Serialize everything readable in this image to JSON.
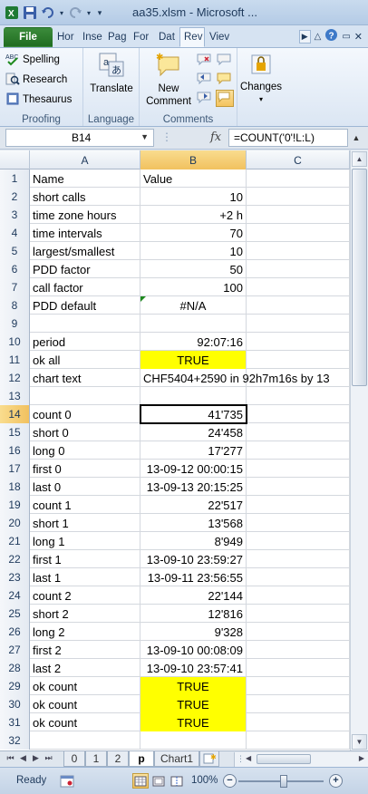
{
  "window": {
    "title": "aa35.xlsm - Microsoft ..."
  },
  "ribbon_tabs": [
    "File",
    "Hor",
    "Inse",
    "Pag",
    "For",
    "Dat",
    "Rev",
    "Viev"
  ],
  "ribbon": {
    "proofing": {
      "spelling": "Spelling",
      "research": "Research",
      "thesaurus": "Thesaurus",
      "label": "Proofing"
    },
    "language": {
      "translate": "Translate",
      "label": "Language"
    },
    "comments": {
      "new_comment_line1": "New",
      "new_comment_line2": "Comment",
      "label": "Comments"
    },
    "changes": {
      "label": "Changes"
    }
  },
  "formula_bar": {
    "name_box": "B14",
    "fx": "fx",
    "formula": "=COUNT('0'!L:L)"
  },
  "columns": [
    "A",
    "B",
    "C"
  ],
  "rows": [
    {
      "n": "1",
      "a": "Name",
      "b": "Value"
    },
    {
      "n": "2",
      "a": "short calls",
      "b": "10"
    },
    {
      "n": "3",
      "a": "time zone hours",
      "b": "+2 h"
    },
    {
      "n": "4",
      "a": "time intervals",
      "b": "70"
    },
    {
      "n": "5",
      "a": "largest/smallest",
      "b": "10"
    },
    {
      "n": "6",
      "a": "PDD factor",
      "b": "50"
    },
    {
      "n": "7",
      "a": "call factor",
      "b": "100"
    },
    {
      "n": "8",
      "a": "PDD default",
      "b": "#N/A"
    },
    {
      "n": "9",
      "a": "",
      "b": ""
    },
    {
      "n": "10",
      "a": "period",
      "b": "92:07:16"
    },
    {
      "n": "11",
      "a": "ok all",
      "b": "TRUE"
    },
    {
      "n": "12",
      "a": "chart text",
      "b": "CHF5404+2590 in 92h7m16s by 13"
    },
    {
      "n": "13",
      "a": "",
      "b": ""
    },
    {
      "n": "14",
      "a": "count 0",
      "b": "41'735"
    },
    {
      "n": "15",
      "a": "short 0",
      "b": "24'458"
    },
    {
      "n": "16",
      "a": "long 0",
      "b": "17'277"
    },
    {
      "n": "17",
      "a": "first 0",
      "b": "13-09-12 00:00:15"
    },
    {
      "n": "18",
      "a": "last 0",
      "b": "13-09-13 20:15:25"
    },
    {
      "n": "19",
      "a": "count 1",
      "b": "22'517"
    },
    {
      "n": "20",
      "a": "short 1",
      "b": "13'568"
    },
    {
      "n": "21",
      "a": "long 1",
      "b": "8'949"
    },
    {
      "n": "22",
      "a": "first 1",
      "b": "13-09-10 23:59:27"
    },
    {
      "n": "23",
      "a": "last 1",
      "b": "13-09-11 23:56:55"
    },
    {
      "n": "24",
      "a": "count 2",
      "b": "22'144"
    },
    {
      "n": "25",
      "a": "short 2",
      "b": "12'816"
    },
    {
      "n": "26",
      "a": "long 2",
      "b": "9'328"
    },
    {
      "n": "27",
      "a": "first 2",
      "b": "13-09-10 00:08:09"
    },
    {
      "n": "28",
      "a": "last 2",
      "b": "13-09-10 23:57:41"
    },
    {
      "n": "29",
      "a": "ok count",
      "b": "TRUE"
    },
    {
      "n": "30",
      "a": "ok count",
      "b": "TRUE"
    },
    {
      "n": "31",
      "a": "ok count",
      "b": "TRUE"
    },
    {
      "n": "32",
      "a": "",
      "b": ""
    }
  ],
  "sheet_tabs": [
    "0",
    "1",
    "2",
    "p",
    "Chart1"
  ],
  "status": {
    "ready": "Ready",
    "zoom": "100%"
  },
  "colors": {
    "highlight": "#ffff00",
    "selection_header": "#f1c15f",
    "file_tab": "#2a7a2a"
  }
}
